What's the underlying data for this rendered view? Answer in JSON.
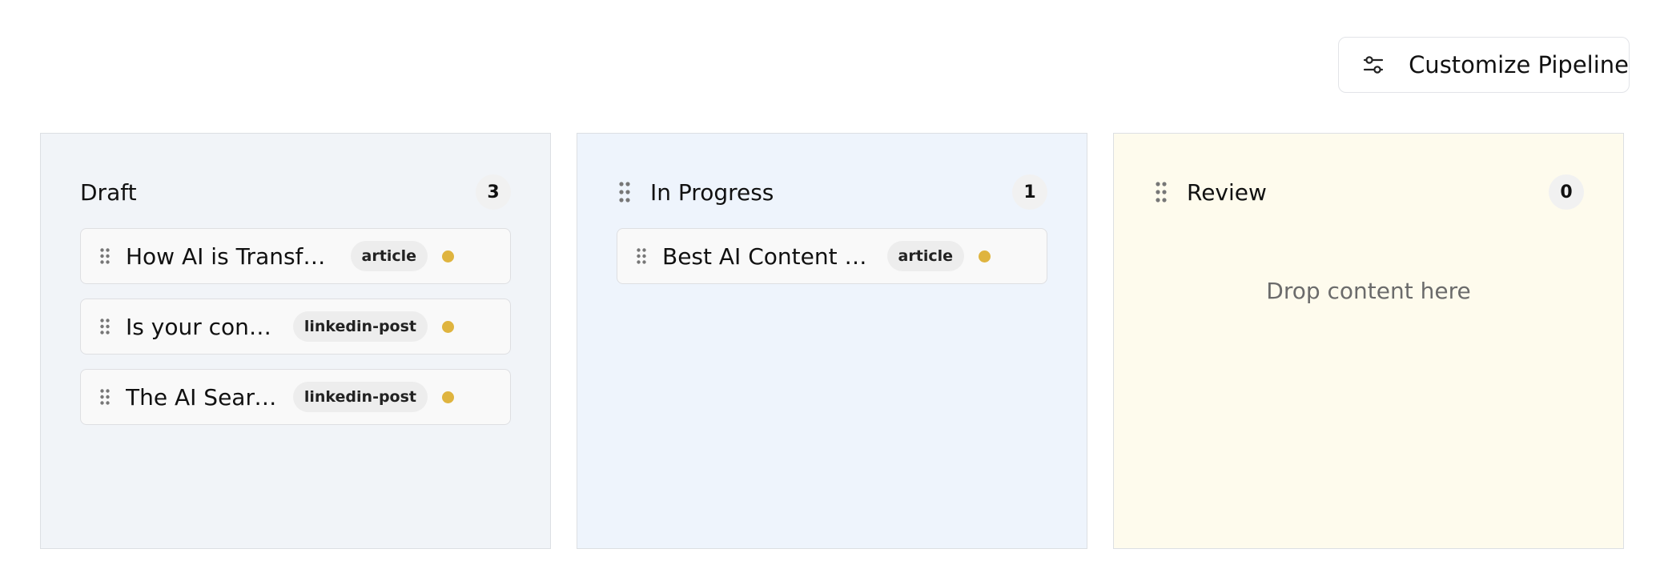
{
  "toolbar": {
    "customize_label": "Customize Pipeline",
    "customize_icon": "sliders-icon"
  },
  "colors": {
    "draft_bg": "#f1f4f8",
    "progress_bg": "#eef4fc",
    "review_bg": "#fefbed",
    "count_bg": "#f1f1f1",
    "status_dot": "#dfb43f",
    "grip": "#777777"
  },
  "columns": [
    {
      "title": "Draft",
      "count": "3",
      "cards": [
        {
          "title": "How AI is Transforming Content",
          "tag": "article"
        },
        {
          "title": "Is your content ready",
          "tag": "linkedin-post"
        },
        {
          "title": "The AI Search Shift",
          "tag": "linkedin-post"
        }
      ]
    },
    {
      "title": "In Progress",
      "count": "1",
      "cards": [
        {
          "title": "Best AI Content Optimization",
          "tag": "article"
        }
      ]
    },
    {
      "title": "Review",
      "count": "0",
      "empty_text": "Drop content here",
      "cards": []
    }
  ]
}
